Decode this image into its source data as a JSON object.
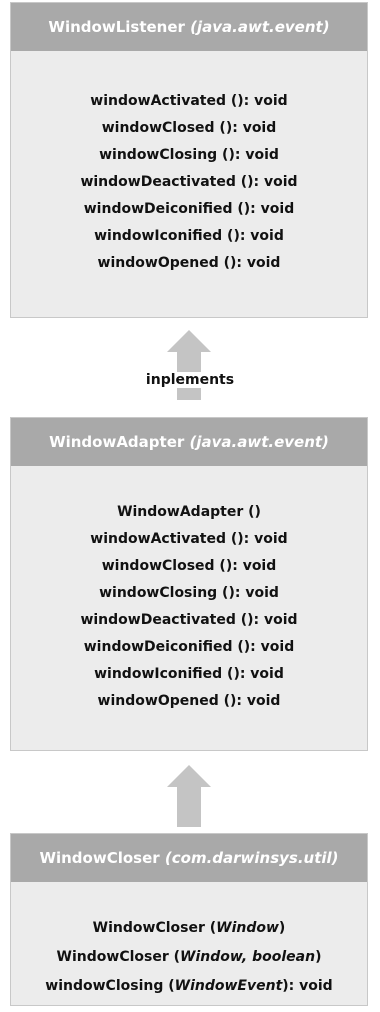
{
  "window_listener": {
    "name": "WindowListener",
    "package": "(java.awt.event)",
    "methods": [
      "windowActivated (): void",
      "windowClosed (): void",
      "windowClosing (): void",
      "windowDeactivated (): void",
      "windowDeiconified (): void",
      "windowIconified (): void",
      "windowOpened (): void"
    ]
  },
  "relation_implements": {
    "label": "inplements"
  },
  "window_adapter": {
    "name": "WindowAdapter",
    "package": "(java.awt.event)",
    "methods": [
      "WindowAdapter ()",
      "windowActivated (): void",
      "windowClosed (): void",
      "windowClosing (): void",
      "windowDeactivated (): void",
      "windowDeiconified (): void",
      "windowIconified (): void",
      "windowOpened (): void"
    ]
  },
  "window_closer": {
    "name": "WindowCloser",
    "package": "(com.darwinsys.util)",
    "methods": [
      {
        "pre": "WindowCloser (",
        "param": "Window",
        "post": ")"
      },
      {
        "pre": "WindowCloser (",
        "param": "Window, boolean",
        "post": ")"
      },
      {
        "pre": "windowClosing (",
        "param": "WindowEvent",
        "post": "): void"
      }
    ]
  },
  "colors": {
    "header_bg": "#a9a9a9",
    "body_bg": "#ececec",
    "arrow": "#c4c4c4"
  }
}
